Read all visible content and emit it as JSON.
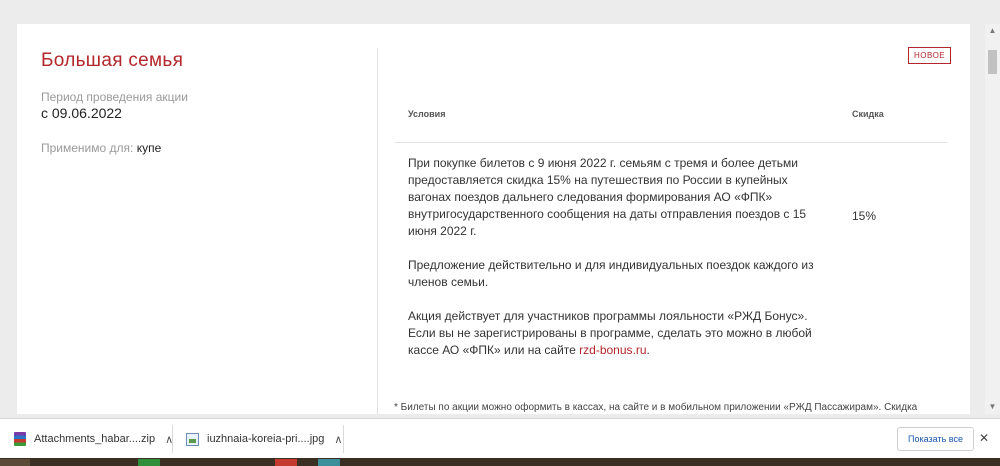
{
  "promo": {
    "title": "Большая семья",
    "period_label": "Период проведения акции",
    "period_value": "с 09.06.2022",
    "applies_label": "Применимо для:",
    "applies_value": "купе",
    "badge": "НОВОЕ"
  },
  "table": {
    "col_conditions": "Условия",
    "col_discount": "Скидка",
    "conditions_p1": "При покупке билетов с 9 июня 2022 г. семьям с тремя и более детьми предоставляется скидка 15% на путешествия по России в купейных вагонах поездов дальнего следования формирования АО «ФПК» внутригосударственного сообщения на даты отправления поездов с 15 июня 2022 г.",
    "conditions_p2": "Предложение действительно и для индивидуальных поездок каждого из членов семьи.",
    "conditions_p3_prefix": "Акция действует для участников программы лояльности «РЖД Бонус». Если вы не зарегистрированы в программе, сделать это можно в любой кассе АО «ФПК» или на сайте ",
    "conditions_link": "rzd-bonus.ru",
    "conditions_p3_suffix": ".",
    "discount_value": "15%",
    "footnote": "* Билеты по акции можно оформить в кассах, на сайте и в мобильном приложении «РЖД Пассажирам». Скидка"
  },
  "downloads": {
    "items": [
      {
        "name": "Attachments_habar....zip",
        "icon": "archive-icon"
      },
      {
        "name": "iuzhnaia-koreia-pri....jpg",
        "icon": "image-file-icon"
      }
    ],
    "show_all": "Показать все",
    "close": "✕"
  },
  "colors": {
    "accent": "#b3262b"
  }
}
